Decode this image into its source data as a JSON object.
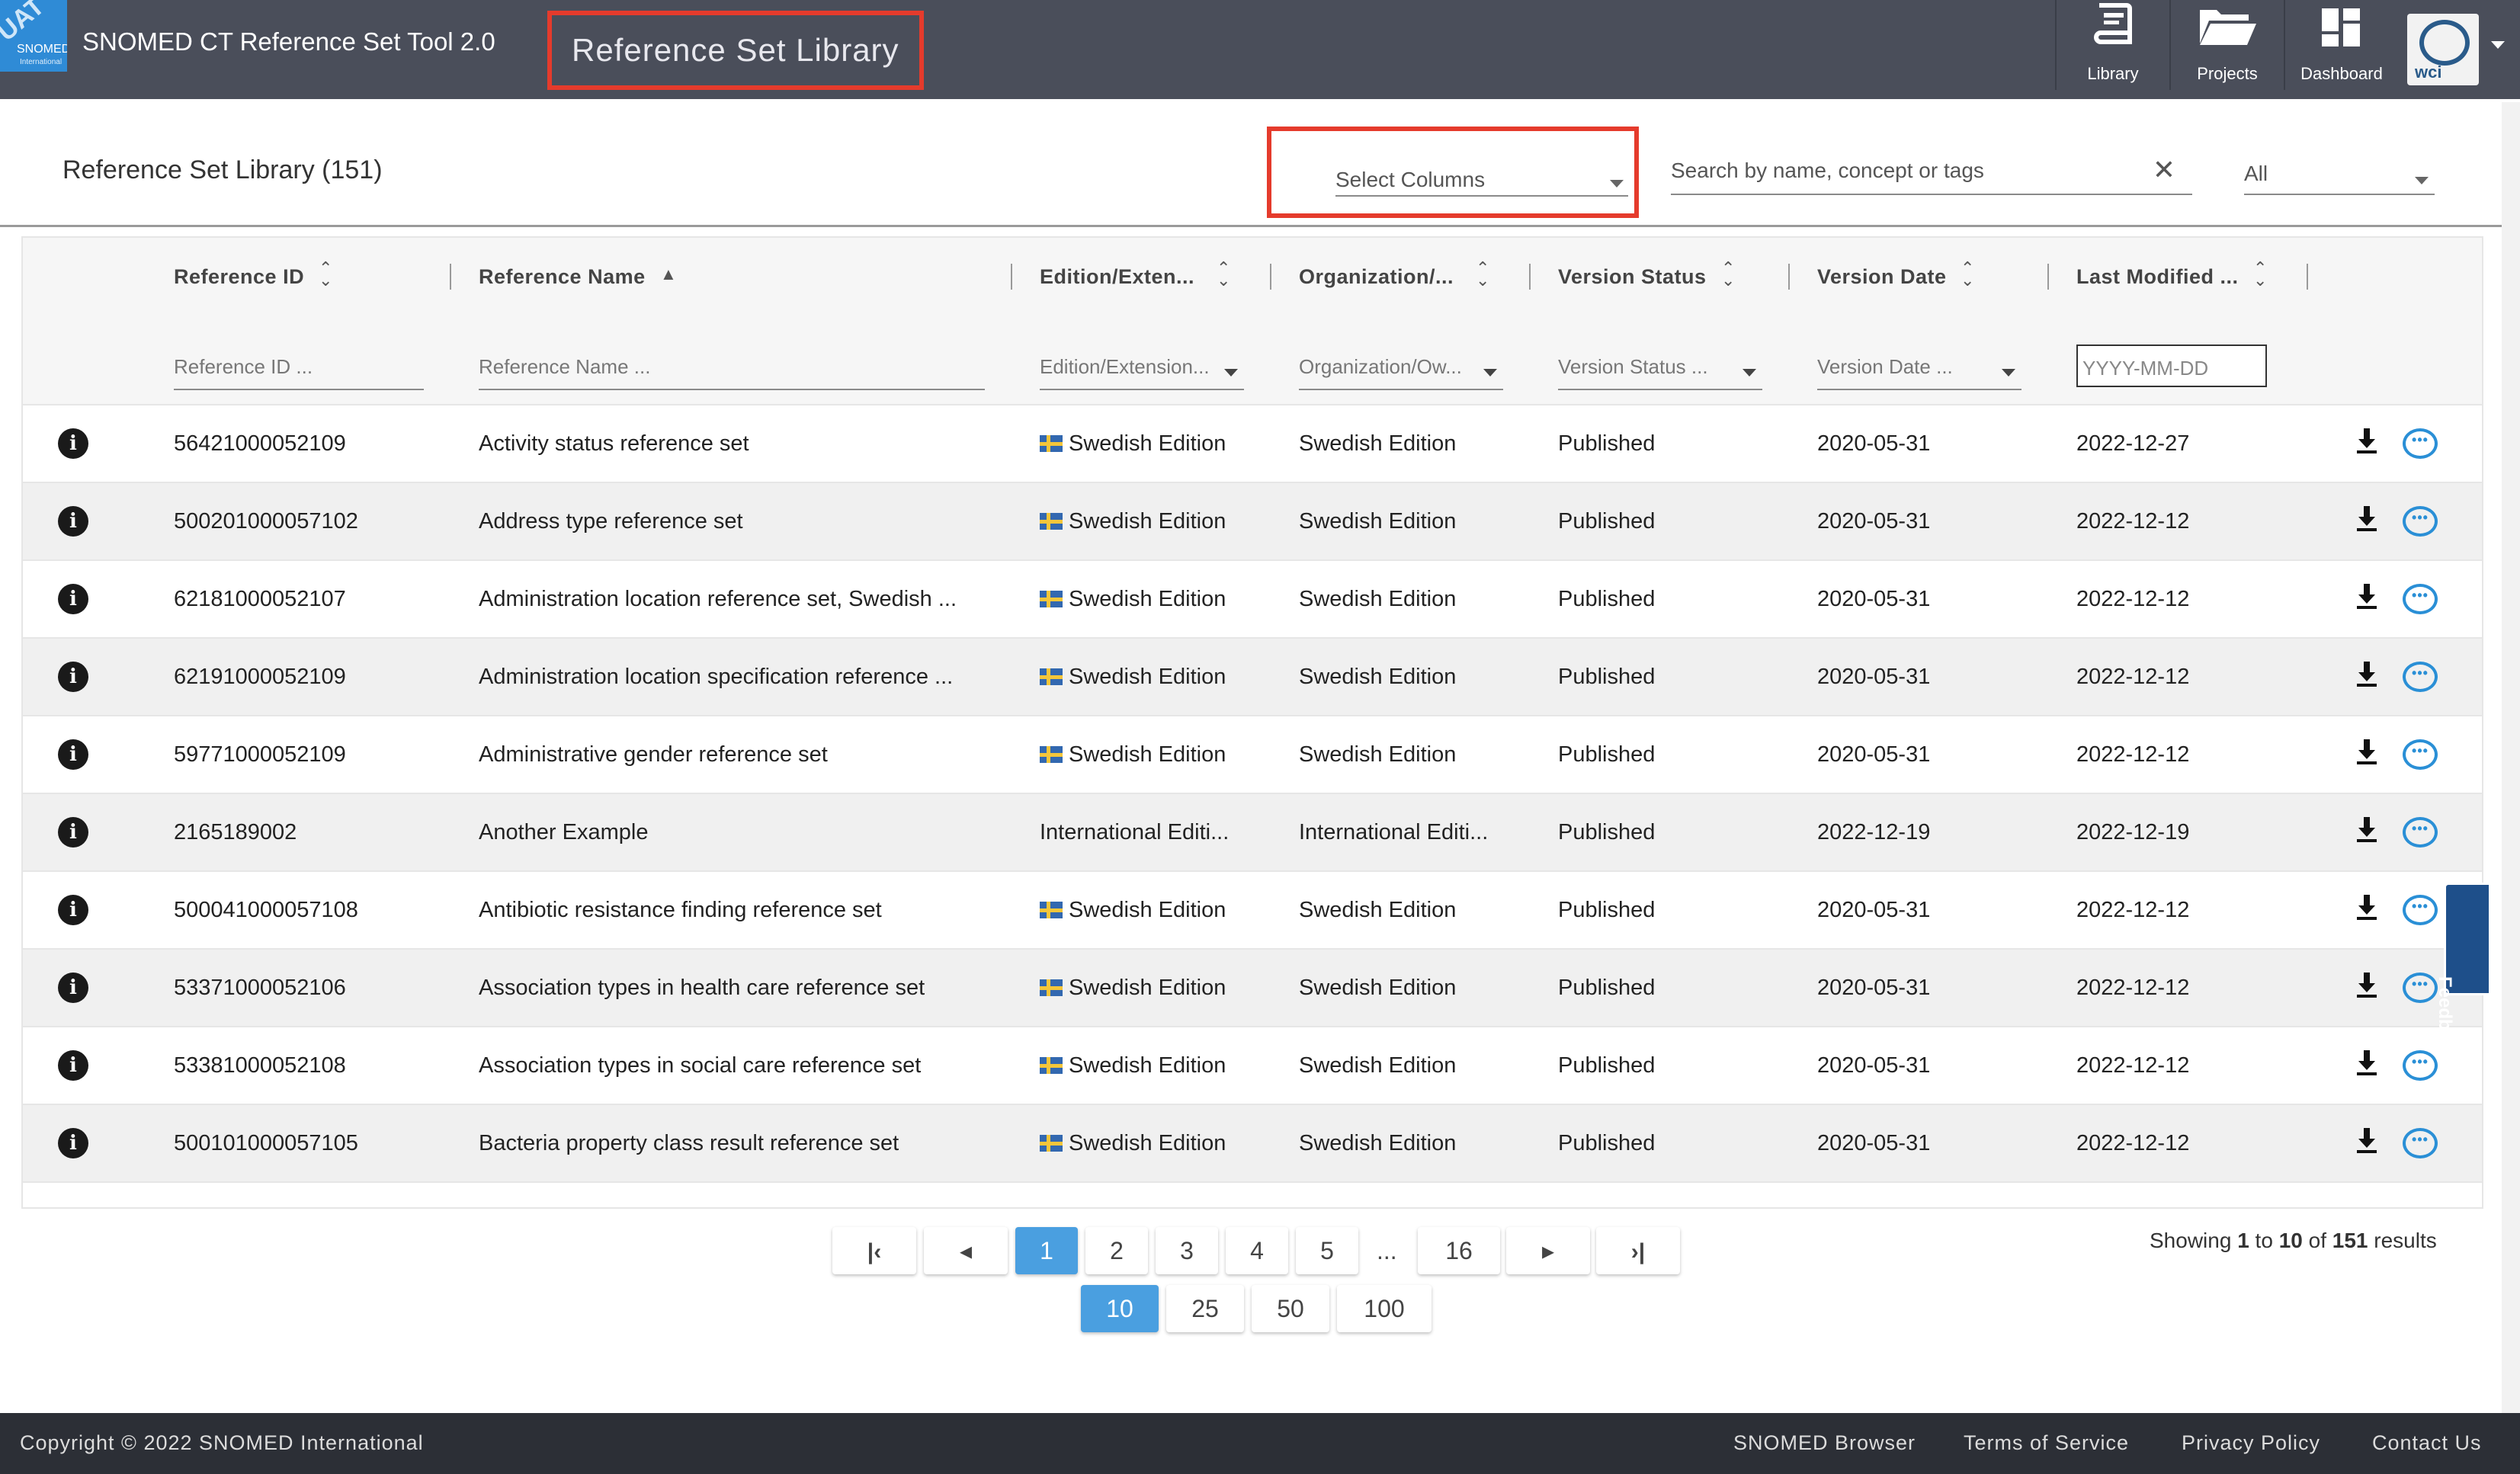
{
  "header": {
    "badge": "UAT",
    "logo_text": "SNOMED",
    "logo_sub": "International",
    "app_title": "SNOMED CT Reference Set Tool 2.0",
    "page_title": "Reference Set Library",
    "nav": [
      {
        "label": "Library",
        "icon": "book-icon"
      },
      {
        "label": "Projects",
        "icon": "folder-open-icon"
      },
      {
        "label": "Dashboard",
        "icon": "dashboard-grid-icon"
      }
    ],
    "avatar_text": "wci"
  },
  "toolbar": {
    "title": "Reference Set Library (151)",
    "select_columns": "Select Columns",
    "search_placeholder": "Search by name, concept or tags",
    "clear_icon": "close-icon",
    "scope_value": "All"
  },
  "table": {
    "columns": [
      {
        "label": "Reference ID",
        "sort": "none"
      },
      {
        "label": "Reference Name",
        "sort": "asc"
      },
      {
        "label": "Edition/Exten...",
        "sort": "none"
      },
      {
        "label": "Organization/...",
        "sort": "none"
      },
      {
        "label": "Version Status",
        "sort": "none"
      },
      {
        "label": "Version Date",
        "sort": "none"
      },
      {
        "label": "Last Modified ...",
        "sort": "none"
      }
    ],
    "filters": {
      "reference_id": "Reference ID ...",
      "reference_name": "Reference Name ...",
      "edition": "Edition/Extension...",
      "organization": "Organization/Ow...",
      "version_status": "Version Status ...",
      "version_date": "Version Date ...",
      "last_modified": "YYYY-MM-DD"
    },
    "rows": [
      {
        "id": "56421000052109",
        "name": "Activity status reference set",
        "edition": "Swedish Edition",
        "flag": true,
        "org": "Swedish Edition",
        "status": "Published",
        "vdate": "2020-05-31",
        "modified": "2022-12-27"
      },
      {
        "id": "500201000057102",
        "name": "Address type reference set",
        "edition": "Swedish Edition",
        "flag": true,
        "org": "Swedish Edition",
        "status": "Published",
        "vdate": "2020-05-31",
        "modified": "2022-12-12"
      },
      {
        "id": "62181000052107",
        "name": "Administration location reference set, Swedish ...",
        "edition": "Swedish Edition",
        "flag": true,
        "org": "Swedish Edition",
        "status": "Published",
        "vdate": "2020-05-31",
        "modified": "2022-12-12"
      },
      {
        "id": "62191000052109",
        "name": "Administration location specification reference ...",
        "edition": "Swedish Edition",
        "flag": true,
        "org": "Swedish Edition",
        "status": "Published",
        "vdate": "2020-05-31",
        "modified": "2022-12-12"
      },
      {
        "id": "59771000052109",
        "name": "Administrative gender reference set",
        "edition": "Swedish Edition",
        "flag": true,
        "org": "Swedish Edition",
        "status": "Published",
        "vdate": "2020-05-31",
        "modified": "2022-12-12"
      },
      {
        "id": "2165189002",
        "name": "Another Example",
        "edition": "International Editi...",
        "flag": false,
        "org": "International Editi...",
        "status": "Published",
        "vdate": "2022-12-19",
        "modified": "2022-12-19"
      },
      {
        "id": "500041000057108",
        "name": "Antibiotic resistance finding reference set",
        "edition": "Swedish Edition",
        "flag": true,
        "org": "Swedish Edition",
        "status": "Published",
        "vdate": "2020-05-31",
        "modified": "2022-12-12"
      },
      {
        "id": "53371000052106",
        "name": "Association types in health care reference set",
        "edition": "Swedish Edition",
        "flag": true,
        "org": "Swedish Edition",
        "status": "Published",
        "vdate": "2020-05-31",
        "modified": "2022-12-12"
      },
      {
        "id": "53381000052108",
        "name": "Association types in social care reference set",
        "edition": "Swedish Edition",
        "flag": true,
        "org": "Swedish Edition",
        "status": "Published",
        "vdate": "2020-05-31",
        "modified": "2022-12-12"
      },
      {
        "id": "500101000057105",
        "name": "Bacteria property class result reference set",
        "edition": "Swedish Edition",
        "flag": true,
        "org": "Swedish Edition",
        "status": "Published",
        "vdate": "2020-05-31",
        "modified": "2022-12-12"
      }
    ]
  },
  "feedback_label": "Feedback",
  "pagination": {
    "first": "K",
    "prev": "◂",
    "pages": [
      "1",
      "2",
      "3",
      "4",
      "5"
    ],
    "ellipsis": "...",
    "last_page": "16",
    "next": "▸",
    "last": "›I",
    "current_page": "1",
    "page_sizes": [
      "10",
      "25",
      "50",
      "100"
    ],
    "current_size": "10",
    "showing_prefix": "Showing",
    "showing_from": "1",
    "showing_to_word": "to",
    "showing_to": "10",
    "showing_of_word": "of",
    "showing_total": "151",
    "showing_suffix": "results"
  },
  "footer": {
    "copyright": "Copyright © 2022 SNOMED International",
    "links": [
      "SNOMED Browser",
      "Terms of Service",
      "Privacy Policy",
      "Contact Us"
    ]
  },
  "colors": {
    "topbar": "#4a4e5a",
    "highlight": "#e53b2c",
    "accent": "#4a9fe0",
    "footer": "#2c2f36"
  }
}
